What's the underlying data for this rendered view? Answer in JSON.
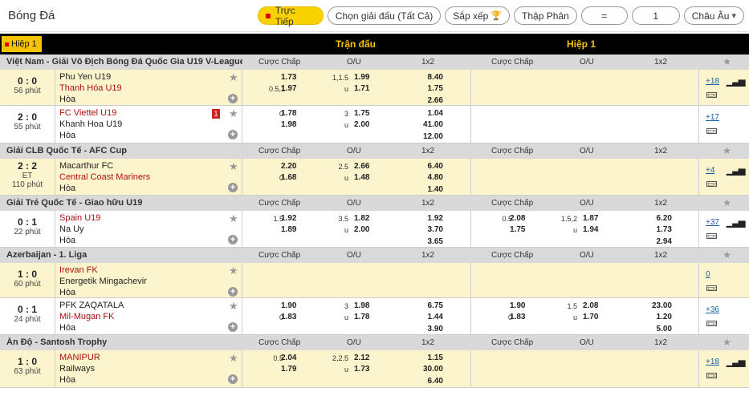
{
  "top": {
    "title": "Bóng Đá",
    "live": "Trực Tiếp",
    "league_filter": "Chọn giải đấu (Tất Cả)",
    "sort": "Sắp xếp",
    "odds_type": "Thập Phân",
    "eq": "=",
    "num": "1",
    "region": "Châu Âu"
  },
  "header": {
    "tab": "Hiệp 1",
    "match": "Trận đấu",
    "half": "Hiệp 1"
  },
  "cols": {
    "hcp": "Cược Chấp",
    "ou": "O/U",
    "x12": "1x2"
  },
  "leagues": [
    {
      "name": "Việt Nam - Giải Vô Địch Bóng Đá Quốc Gia U19 V-League",
      "matches": [
        {
          "score": "0 : 0",
          "time": "56 phút",
          "home": "Phu Yen U19",
          "away": "Thanh Hóa U19",
          "draw": "Hòa",
          "red": "",
          "homeRed": false,
          "awayRed": true,
          "hl": true,
          "hcp_line": [
            "",
            "0.5,1"
          ],
          "hcp": [
            "1.73",
            "1.97"
          ],
          "ou_line": [
            "1,1.5",
            "u"
          ],
          "ou": [
            "1.99",
            "1.71"
          ],
          "x": [
            "8.40",
            "1.75",
            "2.66"
          ],
          "h1_hcp_line": [
            "",
            ""
          ],
          "h1_hcp": [
            "",
            ""
          ],
          "h1_ou_line": [
            "",
            ""
          ],
          "h1_ou": [
            "",
            ""
          ],
          "h1_x": [
            "",
            "",
            ""
          ],
          "more": "+18",
          "stats": true
        },
        {
          "score": "2 : 0",
          "time": "55 phút",
          "home": "FC Viettel U19",
          "away": "Khanh Hoa U19",
          "draw": "Hòa",
          "red": "1",
          "homeRed": true,
          "awayRed": false,
          "hl": false,
          "hcp_line": [
            "0",
            ""
          ],
          "hcp": [
            "1.78",
            "1.98"
          ],
          "ou_line": [
            "3",
            "u"
          ],
          "ou": [
            "1.75",
            "2.00"
          ],
          "x": [
            "1.04",
            "41.00",
            "12.00"
          ],
          "h1_hcp_line": [
            "",
            ""
          ],
          "h1_hcp": [
            "",
            ""
          ],
          "h1_ou_line": [
            "",
            ""
          ],
          "h1_ou": [
            "",
            ""
          ],
          "h1_x": [
            "",
            "",
            ""
          ],
          "more": "+17",
          "stats": false
        }
      ]
    },
    {
      "name": "Giải CLB Quốc Tế - AFC Cup",
      "matches": [
        {
          "score": "2 : 2",
          "et": "ET",
          "time": "110 phút",
          "home": "Macarthur FC",
          "away": "Central Coast Mariners",
          "draw": "Hòa",
          "red": "",
          "homeRed": false,
          "awayRed": true,
          "hl": true,
          "hcp_line": [
            "",
            "0"
          ],
          "hcp": [
            "2.20",
            "1.68"
          ],
          "ou_line": [
            "2.5",
            "u"
          ],
          "ou": [
            "2.66",
            "1.48"
          ],
          "x": [
            "6.40",
            "4.80",
            "1.40"
          ],
          "h1_hcp_line": [
            "",
            ""
          ],
          "h1_hcp": [
            "",
            ""
          ],
          "h1_ou_line": [
            "",
            ""
          ],
          "h1_ou": [
            "",
            ""
          ],
          "h1_x": [
            "",
            "",
            ""
          ],
          "more": "+4",
          "stats": true
        }
      ]
    },
    {
      "name": "Giải Trẻ Quốc Tế - Giao hữu U19",
      "matches": [
        {
          "score": "0 : 1",
          "time": "22 phút",
          "home": "Spain U19",
          "away": "Na Uy",
          "draw": "Hòa",
          "red": "",
          "homeRed": true,
          "awayRed": false,
          "hl": false,
          "hcp_line": [
            "1.5",
            ""
          ],
          "hcp": [
            "1.92",
            "1.89"
          ],
          "ou_line": [
            "3.5",
            "u"
          ],
          "ou": [
            "1.82",
            "2.00"
          ],
          "x": [
            "1.92",
            "3.70",
            "3.65"
          ],
          "h1_hcp_line": [
            "0.5",
            ""
          ],
          "h1_hcp": [
            "2.08",
            "1.75"
          ],
          "h1_ou_line": [
            "1.5,2",
            "u"
          ],
          "h1_ou": [
            "1.87",
            "1.94"
          ],
          "h1_x": [
            "6.20",
            "1.73",
            "2.94"
          ],
          "more": "+37",
          "stats": true
        }
      ]
    },
    {
      "name": "Azerbaijan - 1. Liga",
      "matches": [
        {
          "score": "1 : 0",
          "time": "60 phút",
          "home": "Irevan FK",
          "away": "Energetik Mingachevir",
          "draw": "Hòa",
          "red": "",
          "homeRed": true,
          "awayRed": false,
          "hl": true,
          "hcp_line": [
            "",
            ""
          ],
          "hcp": [
            "",
            ""
          ],
          "ou_line": [
            "",
            ""
          ],
          "ou": [
            "",
            ""
          ],
          "x": [
            "",
            "",
            ""
          ],
          "h1_hcp_line": [
            "",
            ""
          ],
          "h1_hcp": [
            "",
            ""
          ],
          "h1_ou_line": [
            "",
            ""
          ],
          "h1_ou": [
            "",
            ""
          ],
          "h1_x": [
            "",
            "",
            ""
          ],
          "more": "0",
          "stats": false
        },
        {
          "score": "0 : 1",
          "time": "24 phút",
          "home": "PFK ZAQATALA",
          "away": "Mil-Mugan FK",
          "draw": "Hòa",
          "red": "",
          "homeRed": false,
          "awayRed": true,
          "hl": false,
          "hcp_line": [
            "",
            "0"
          ],
          "hcp": [
            "1.90",
            "1.83"
          ],
          "ou_line": [
            "3",
            "u"
          ],
          "ou": [
            "1.98",
            "1.78"
          ],
          "x": [
            "6.75",
            "1.44",
            "3.90"
          ],
          "h1_hcp_line": [
            "",
            "0"
          ],
          "h1_hcp": [
            "1.90",
            "1.83"
          ],
          "h1_ou_line": [
            "1.5",
            "u"
          ],
          "h1_ou": [
            "2.08",
            "1.70"
          ],
          "h1_x": [
            "23.00",
            "1.20",
            "5.00"
          ],
          "more": "+36",
          "stats": false
        }
      ]
    },
    {
      "name": "Ấn Độ - Santosh Trophy",
      "matches": [
        {
          "score": "1 : 0",
          "time": "63 phút",
          "home": "MANIPUR",
          "away": "Railways",
          "draw": "Hòa",
          "red": "",
          "homeRed": true,
          "awayRed": false,
          "hl": true,
          "hcp_line": [
            "0.5",
            ""
          ],
          "hcp": [
            "2.04",
            "1.79"
          ],
          "ou_line": [
            "2,2.5",
            "u"
          ],
          "ou": [
            "2.12",
            "1.73"
          ],
          "x": [
            "1.15",
            "30.00",
            "6.40"
          ],
          "h1_hcp_line": [
            "",
            ""
          ],
          "h1_hcp": [
            "",
            ""
          ],
          "h1_ou_line": [
            "",
            ""
          ],
          "h1_ou": [
            "",
            ""
          ],
          "h1_x": [
            "",
            "",
            ""
          ],
          "more": "+18",
          "stats": true
        }
      ]
    }
  ]
}
